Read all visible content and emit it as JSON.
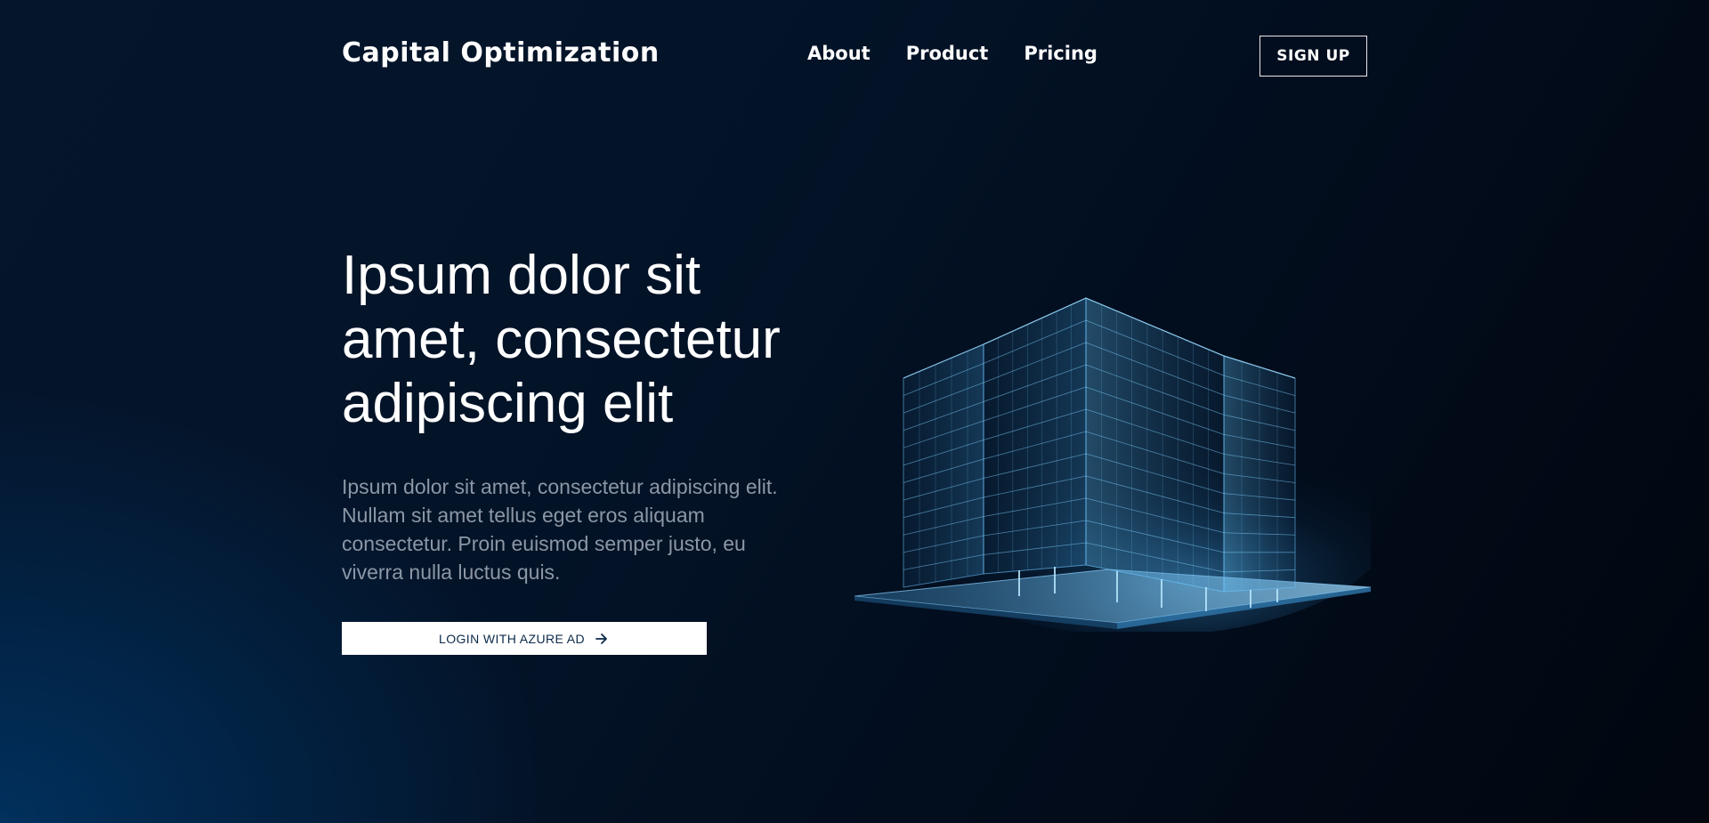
{
  "header": {
    "brand": "Capital Optimization",
    "nav": [
      {
        "label": "About"
      },
      {
        "label": "Product"
      },
      {
        "label": "Pricing"
      }
    ],
    "signup_label": "SIGN UP"
  },
  "hero": {
    "title": "Ipsum dolor sit amet, consectetur adipiscing elit",
    "description": "Ipsum dolor sit amet, consectetur adipiscing elit. Nullam sit amet tellus eget eros aliquam consectetur. Proin euismod semper justo, eu viverra nulla luctus quis.",
    "login_label": "LOGIN WITH AZURE AD",
    "login_icon": "arrow-right-icon"
  },
  "illustration": {
    "icon": "wireframe-building-illustration"
  },
  "colors": {
    "background_dark": "#01060f",
    "background_blue": "#003566",
    "text_primary": "#ffffff",
    "text_muted": "#8c97a6",
    "button_text": "#0b2a4a",
    "wireframe": "#6fc6ff"
  }
}
